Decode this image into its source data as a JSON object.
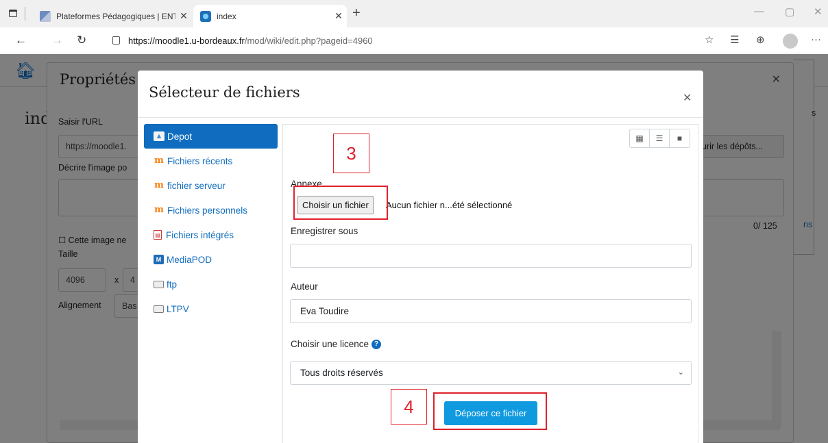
{
  "browser": {
    "tabs": [
      {
        "title": "Plateformes Pédagogiques | ENT"
      },
      {
        "title": "index"
      }
    ],
    "url": {
      "host": "https://moodle1.u-bordeaux.fr",
      "path": "/mod/wiki/edit.php?pageid=4960"
    }
  },
  "background": {
    "heading_fragment": "ind",
    "dialog_title": "Propriétés d",
    "url_label": "Saisir l'URL",
    "url_value": "https://moodle1.",
    "describe_label": "Décrire l'image po",
    "char_count": "0/ 125",
    "decorative_checkbox": "☐ Cette image ne",
    "size_label": "Taille",
    "width_value": "4096",
    "times": "x",
    "height_value": "4",
    "align_label": "Alignement",
    "align_value": "Bas",
    "browse_repos": "urir les dépôts...",
    "side_text_1": "s",
    "side_text_2": "ns"
  },
  "file_picker": {
    "title": "Sélecteur de fichiers",
    "repositories": [
      {
        "label": "Depot",
        "icon": "upload-icon",
        "active": true
      },
      {
        "label": "Fichiers récents",
        "icon": "moodle-icon"
      },
      {
        "label": "fichier serveur",
        "icon": "moodle-icon"
      },
      {
        "label": "Fichiers personnels",
        "icon": "moodle-icon"
      },
      {
        "label": "Fichiers intégrés",
        "icon": "pdf-icon"
      },
      {
        "label": "MediaPOD",
        "icon": "mediapod-icon"
      },
      {
        "label": "ftp",
        "icon": "folder-box-icon"
      },
      {
        "label": "LTPV",
        "icon": "folder-box-icon"
      }
    ],
    "attachment_label": "Annexe",
    "choose_file_button": "Choisir un fichier",
    "no_file_text": "Aucun fichier n...été sélectionné",
    "save_as_label": "Enregistrer sous",
    "save_as_value": "",
    "author_label": "Auteur",
    "author_value": "Eva Toudire",
    "license_label": "Choisir une licence",
    "license_value": "Tous droits réservés",
    "upload_button": "Déposer ce fichier"
  },
  "annotations": {
    "step_3": "3",
    "step_4": "4",
    "color": "#e0202a"
  },
  "colors": {
    "accent": "#0f6cbf",
    "upload_button": "#0f9ae0"
  }
}
